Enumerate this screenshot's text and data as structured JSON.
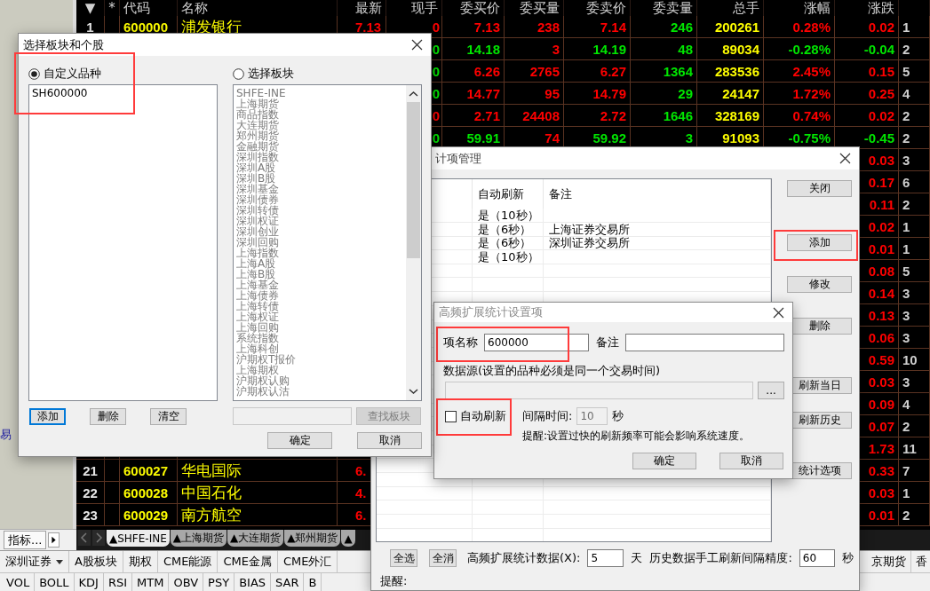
{
  "sidebar": {
    "fragment": "易",
    "tab": "指标..."
  },
  "quote_table": {
    "columns": [
      "▼",
      "*",
      "代码",
      "名称",
      "最新",
      "现手",
      "委买价",
      "委买量",
      "委卖价",
      "委卖量",
      "总手",
      "涨幅",
      "涨跌"
    ],
    "rows": [
      {
        "num": "1",
        "code": "600000",
        "name": "浦发银行",
        "latest": "7.13",
        "tick": "0",
        "bid": "7.13",
        "bid_vol": "238",
        "ask": "7.14",
        "ask_vol": "246",
        "volume": "200261",
        "change_pct": "0.28%",
        "change": "0.02",
        "column_14": "1",
        "rising": true,
        "tick_rising": true
      },
      {
        "tick": "0",
        "bid": "14.18",
        "bid_vol": "3",
        "ask": "14.19",
        "ask_vol": "48",
        "volume": "89034",
        "change_pct": "-0.28%",
        "change": "-0.04",
        "column_14": "2",
        "rising": false,
        "tick_rising": false
      },
      {
        "tick": "0",
        "bid": "6.26",
        "bid_vol": "2765",
        "ask": "6.27",
        "ask_vol": "1364",
        "volume": "283536",
        "change_pct": "2.45%",
        "change": "0.15",
        "column_14": "5",
        "rising": true,
        "tick_rising": false
      },
      {
        "tick": "0",
        "bid": "14.77",
        "bid_vol": "95",
        "ask": "14.79",
        "ask_vol": "29",
        "volume": "24147",
        "change_pct": "1.72%",
        "change": "0.25",
        "column_14": "4",
        "rising": true,
        "tick_rising": false
      },
      {
        "tick": "0",
        "bid": "2.71",
        "bid_vol": "24408",
        "ask": "2.72",
        "ask_vol": "1646",
        "volume": "328169",
        "change_pct": "0.74%",
        "change": "0.02",
        "column_14": "2",
        "rising": true,
        "tick_rising": true
      },
      {
        "tick": "0",
        "bid": "59.91",
        "bid_vol": "74",
        "ask": "59.92",
        "ask_vol": "3",
        "volume": "91093",
        "change_pct": "-0.75%",
        "change": "-0.45",
        "column_14": "2",
        "rising": false,
        "tick_rising": false
      },
      {
        "change": "0.03",
        "column_14": "3",
        "rising": true
      },
      {
        "change": "0.17",
        "column_14": "6",
        "rising": true
      },
      {
        "change": "0.11",
        "column_14": "2",
        "rising": true
      },
      {
        "change": "0.02",
        "column_14": "1",
        "rising": true
      },
      {
        "change": "0.01",
        "column_14": "1",
        "rising": true
      },
      {
        "change": "0.08",
        "column_14": "5",
        "rising": true
      },
      {
        "change": "0.14",
        "column_14": "3",
        "rising": true
      },
      {
        "change": "0.13",
        "column_14": "3",
        "rising": true
      },
      {
        "change": "0.06",
        "column_14": "3",
        "rising": true
      },
      {
        "change": "0.59",
        "column_14": "10",
        "rising": true
      },
      {
        "change": "0.03",
        "column_14": "3",
        "rising": true
      },
      {
        "change": "0.09",
        "column_14": "4",
        "rising": true
      },
      {
        "change": "0.07",
        "column_14": "2",
        "rising": true
      },
      {
        "change": "1.73",
        "column_14": "11",
        "rising": true
      },
      {
        "num": "21",
        "code": "600027",
        "name": "华电国际",
        "latest": "6.",
        "change": "0.33",
        "column_14": "7",
        "rising": true
      },
      {
        "num": "22",
        "code": "600028",
        "name": "中国石化",
        "latest": "4.",
        "change": "0.03",
        "column_14": "1",
        "rising": true
      },
      {
        "num": "23",
        "code": "600029",
        "name": "南方航空",
        "latest": "6.",
        "change": "0.01",
        "column_14": "2",
        "rising": true
      }
    ]
  },
  "sheet_tabs": [
    {
      "label": "▲SHFE-INE",
      "selected": true
    },
    {
      "label": "▲上海期货",
      "selected": false
    },
    {
      "label": "▲大连期货",
      "selected": false
    },
    {
      "label": "▲郑州期货",
      "selected": false
    },
    {
      "label": "▲",
      "selected": false
    }
  ],
  "category_bar": {
    "items": [
      {
        "label": "深圳证券",
        "dropdown": true
      },
      {
        "label": "A股板块",
        "dropdown": false
      },
      {
        "label": "期权",
        "dropdown": false
      },
      {
        "label": "CME能源",
        "dropdown": false
      },
      {
        "label": "CME金属",
        "dropdown": false
      },
      {
        "label": "CME外汇",
        "dropdown": false
      }
    ],
    "right_items": [
      "京期货",
      "香"
    ]
  },
  "indicator_bar": [
    "VOL",
    "BOLL",
    "KDJ",
    "RSI",
    "MTM",
    "OBV",
    "PSY",
    "BIAS",
    "SAR",
    "B"
  ],
  "manage_dialog": {
    "title": "计项管理",
    "columns": [
      "自动刷新",
      "备注"
    ],
    "rows": [
      {
        "auto_refresh": "是（10秒）"
      },
      {
        "auto_refresh": "是（6秒）",
        "note": "上海证券交易所"
      },
      {
        "auto_refresh": "是（6秒）",
        "note": "深圳证券交易所"
      },
      {
        "auto_refresh": "是（10秒）"
      }
    ],
    "buttons": [
      {
        "label": "关闭",
        "highlighted": false
      },
      {
        "label": "添加",
        "highlighted": true
      },
      {
        "label": "修改",
        "highlighted": false
      },
      {
        "label": "删除",
        "highlighted": false
      },
      {
        "label": "刷新当日",
        "highlighted": false
      },
      {
        "label": "刷新历史",
        "highlighted": false
      },
      {
        "label": "统计选项",
        "highlighted": false
      }
    ],
    "footer": {
      "select_all": "全选",
      "clear_all": "全消",
      "days_label": "高频扩展统计数据(X):",
      "days_value": "5",
      "days_unit": "天",
      "interval_label": "历史数据手工刷新间隔精度:",
      "interval_value": "60",
      "interval_unit": "秒",
      "reminder": "提醒:"
    }
  },
  "settings_dialog": {
    "title": "高频扩展统计设置项",
    "name_label": "项名称",
    "name_value": "600000",
    "name_highlighted": true,
    "note_label": "备注",
    "source_label": "数据源(设置的品种必须是同一个交易时间)",
    "source_button": "...",
    "auto_refresh": {
      "label": "自动刷新",
      "checked": false,
      "highlighted": true
    },
    "interval_label": "间隔时间:",
    "interval_value": "10",
    "interval_disabled": true,
    "interval_unit": "秒",
    "reminder": "提醒:设置过快的刷新频率可能会影响系统速度。",
    "ok": "确定",
    "cancel": "取消"
  },
  "stock_dialog": {
    "title": "选择板块和个股",
    "custom": {
      "label": "自定义品种",
      "selected": true,
      "highlighted": true,
      "items": [
        "SH600000"
      ]
    },
    "sector": {
      "label": "选择板块",
      "selected": false,
      "items": [
        "SHFE-INE",
        "上海期货",
        "商品指数",
        "大连期货",
        "郑州期货",
        "金融期货",
        "深圳指数",
        "深圳A股",
        "深圳B股",
        "深圳基金",
        "深圳债券",
        "深圳转债",
        "深圳权证",
        "深圳创业",
        "深圳回购",
        "上海指数",
        "上海A股",
        "上海B股",
        "上海基金",
        "上海债券",
        "上海转债",
        "上海权证",
        "上海回购",
        "系统指数",
        "上海科创",
        "沪期权T报价",
        "上海期权",
        "沪期权认购",
        "沪期权认沽"
      ]
    },
    "left_buttons": [
      {
        "label": "添加",
        "focused": true
      },
      {
        "label": "删除",
        "focused": false
      },
      {
        "label": "清空",
        "focused": false
      }
    ],
    "find_button": {
      "label": "查找板块",
      "disabled": true
    },
    "ok": "确定",
    "cancel": "取消"
  }
}
